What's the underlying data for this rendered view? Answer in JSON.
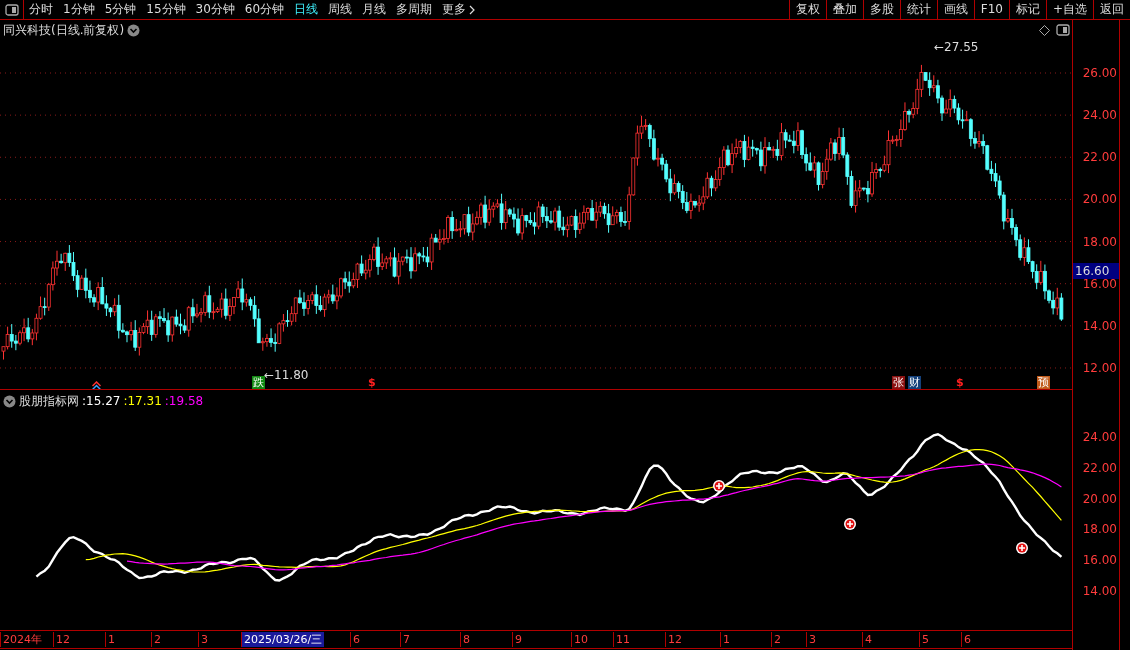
{
  "toolbar": {
    "periods": [
      {
        "label": "分时",
        "selected": false
      },
      {
        "label": "1分钟",
        "selected": false
      },
      {
        "label": "5分钟",
        "selected": false
      },
      {
        "label": "15分钟",
        "selected": false
      },
      {
        "label": "30分钟",
        "selected": false
      },
      {
        "label": "60分钟",
        "selected": false
      },
      {
        "label": "日线",
        "selected": true
      },
      {
        "label": "周线",
        "selected": false
      },
      {
        "label": "月线",
        "selected": false
      },
      {
        "label": "多周期",
        "selected": false
      },
      {
        "label": "更多",
        "selected": false
      }
    ],
    "buttons": [
      "复权",
      "叠加",
      "多股",
      "统计",
      "画线",
      "F10",
      "标记",
      "+自选",
      "返回"
    ]
  },
  "main_chart": {
    "title": "同兴科技(日线.前复权)",
    "high_label": "←27.55",
    "low_label": "←11.80",
    "current_price": "16.60",
    "yticks": [
      "26.00",
      "24.00",
      "22.00",
      "20.00",
      "18.00",
      "16.00",
      "14.00",
      "12.00"
    ],
    "markers": [
      {
        "text": "跌",
        "color": "#118811",
        "kind": "boxed"
      },
      {
        "text": "$",
        "color": "#ff2020",
        "kind": "plain"
      },
      {
        "text": "张",
        "color": "#8a1010",
        "kind": "boxed"
      },
      {
        "text": "财",
        "color": "#14407a",
        "kind": "boxed"
      },
      {
        "text": "$",
        "color": "#ff2020",
        "kind": "plain"
      },
      {
        "text": "预",
        "color": "#c05a1a",
        "kind": "boxed"
      }
    ]
  },
  "indicator": {
    "name": "股朋指标网",
    "values": [
      {
        "text": ":15.27",
        "color": "#ffffff"
      },
      {
        "text": ":17.31",
        "color": "#ffff00"
      },
      {
        "text": ":19.58",
        "color": "#ff00ff"
      }
    ],
    "yticks": [
      "24.00",
      "22.00",
      "20.00",
      "18.00",
      "16.00",
      "14.00"
    ]
  },
  "date_axis": [
    {
      "label": "2024年",
      "selected": false
    },
    {
      "label": "12",
      "selected": false
    },
    {
      "label": "1",
      "selected": false
    },
    {
      "label": "2",
      "selected": false
    },
    {
      "label": "3",
      "selected": false
    },
    {
      "label": "2025/03/26/三",
      "selected": true
    },
    {
      "label": "6",
      "selected": false
    },
    {
      "label": "7",
      "selected": false
    },
    {
      "label": "8",
      "selected": false
    },
    {
      "label": "9",
      "selected": false
    },
    {
      "label": "10",
      "selected": false
    },
    {
      "label": "11",
      "selected": false
    },
    {
      "label": "12",
      "selected": false
    },
    {
      "label": "1",
      "selected": false
    },
    {
      "label": "2",
      "selected": false
    },
    {
      "label": "3",
      "selected": false
    },
    {
      "label": "4",
      "selected": false
    },
    {
      "label": "5",
      "selected": false
    },
    {
      "label": "6",
      "selected": false
    }
  ]
}
